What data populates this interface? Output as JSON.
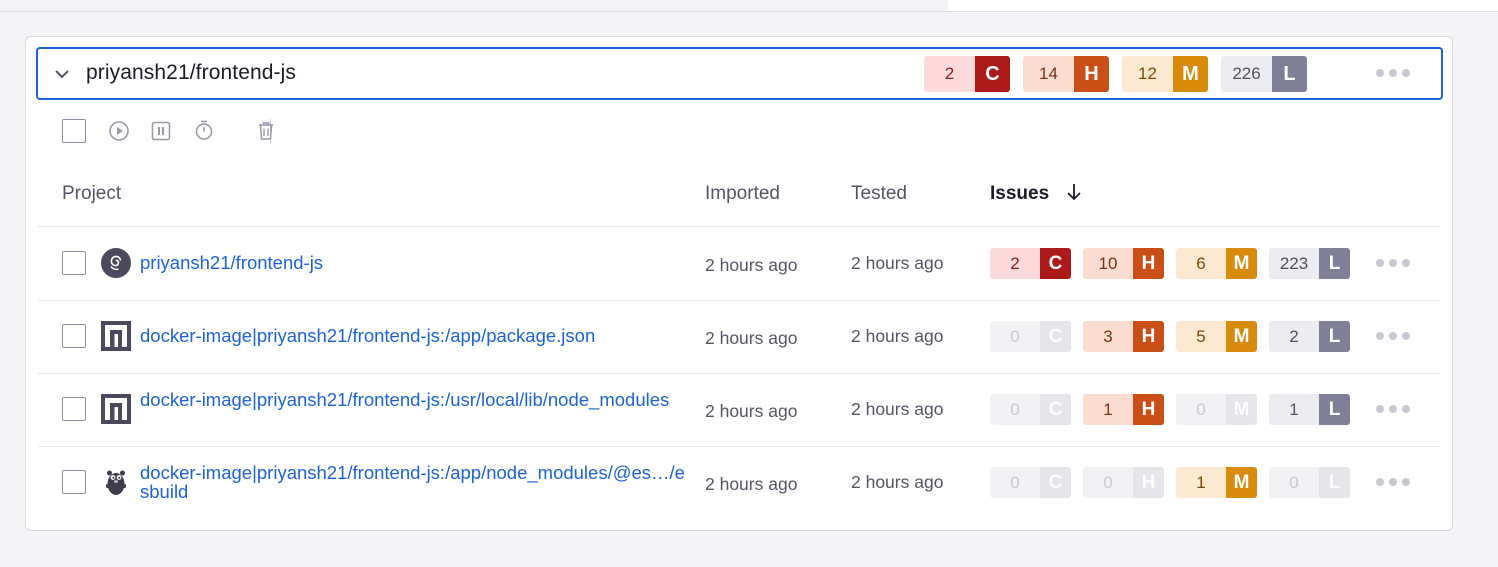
{
  "group": {
    "title": "priyansh21/frontend-js",
    "counts": [
      {
        "level": "C",
        "count": "2",
        "kind": "c"
      },
      {
        "level": "H",
        "count": "14",
        "kind": "h"
      },
      {
        "level": "M",
        "count": "12",
        "kind": "m"
      },
      {
        "level": "L",
        "count": "226",
        "kind": "l"
      }
    ]
  },
  "columns": {
    "project": "Project",
    "imported": "Imported",
    "tested": "Tested",
    "issues": "Issues"
  },
  "rows": [
    {
      "name": "priyansh21/frontend-js",
      "icon": "debian-icon",
      "imported": "2 hours ago",
      "tested": "2 hours ago",
      "counts": [
        {
          "level": "C",
          "count": "2",
          "kind": "c"
        },
        {
          "level": "H",
          "count": "10",
          "kind": "h"
        },
        {
          "level": "M",
          "count": "6",
          "kind": "m"
        },
        {
          "level": "L",
          "count": "223",
          "kind": "l"
        }
      ]
    },
    {
      "name": "docker-image|priyansh21/frontend-js:/app/package.json",
      "icon": "npm-icon",
      "imported": "2 hours ago",
      "tested": "2 hours ago",
      "counts": [
        {
          "level": "C",
          "count": "0",
          "kind": "z"
        },
        {
          "level": "H",
          "count": "3",
          "kind": "h"
        },
        {
          "level": "M",
          "count": "5",
          "kind": "m"
        },
        {
          "level": "L",
          "count": "2",
          "kind": "l"
        }
      ]
    },
    {
      "name": "docker-image|priyansh21/frontend-js:/usr/local/lib/node_modules",
      "icon": "npm-icon",
      "imported": "2 hours ago",
      "tested": "2 hours ago",
      "counts": [
        {
          "level": "C",
          "count": "0",
          "kind": "z"
        },
        {
          "level": "H",
          "count": "1",
          "kind": "h"
        },
        {
          "level": "M",
          "count": "0",
          "kind": "z"
        },
        {
          "level": "L",
          "count": "1",
          "kind": "l"
        }
      ]
    },
    {
      "name": "docker-image|priyansh21/frontend-js:/app/node_modules/@es…/esbuild",
      "icon": "gopher-icon",
      "imported": "2 hours ago",
      "tested": "2 hours ago",
      "counts": [
        {
          "level": "C",
          "count": "0",
          "kind": "z"
        },
        {
          "level": "H",
          "count": "0",
          "kind": "z"
        },
        {
          "level": "M",
          "count": "1",
          "kind": "m"
        },
        {
          "level": "L",
          "count": "0",
          "kind": "z"
        }
      ]
    }
  ]
}
